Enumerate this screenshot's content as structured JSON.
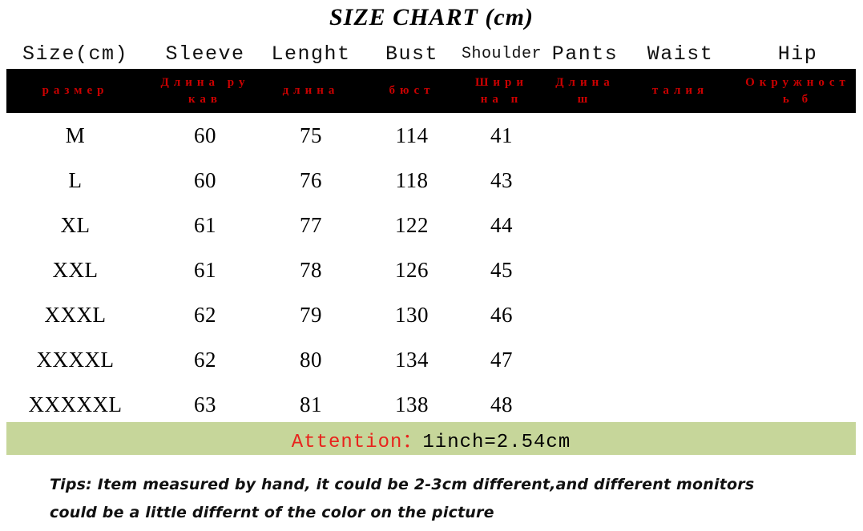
{
  "title": "SIZE CHART (cm)",
  "colors": {
    "band_black": "#000000",
    "cyrillic_red": "#cc0000",
    "attention_red": "#e8231c",
    "attention_band_green": "#c6d69a",
    "text_black": "#000000",
    "background": "#ffffff"
  },
  "table": {
    "headers_en": [
      "Size(cm)",
      "Sleeve",
      "Lenght",
      "Bust",
      "Shoulder",
      "Pants",
      "Waist",
      "Hip"
    ],
    "headers_ru": [
      "размер",
      "Длина рукав",
      "длина",
      "бюст",
      "Ширина п",
      "Длина ш",
      "талия",
      "Окружность б"
    ],
    "rows": [
      {
        "size": "M",
        "sleeve": "60",
        "length": "75",
        "bust": "114",
        "shoulder": "41",
        "pants": "",
        "waist": "",
        "hip": ""
      },
      {
        "size": "L",
        "sleeve": "60",
        "length": "76",
        "bust": "118",
        "shoulder": "43",
        "pants": "",
        "waist": "",
        "hip": ""
      },
      {
        "size": "XL",
        "sleeve": "61",
        "length": "77",
        "bust": "122",
        "shoulder": "44",
        "pants": "",
        "waist": "",
        "hip": ""
      },
      {
        "size": "XXL",
        "sleeve": "61",
        "length": "78",
        "bust": "126",
        "shoulder": "45",
        "pants": "",
        "waist": "",
        "hip": ""
      },
      {
        "size": "XXXL",
        "sleeve": "62",
        "length": "79",
        "bust": "130",
        "shoulder": "46",
        "pants": "",
        "waist": "",
        "hip": ""
      },
      {
        "size": "XXXXL",
        "sleeve": "62",
        "length": "80",
        "bust": "134",
        "shoulder": "47",
        "pants": "",
        "waist": "",
        "hip": ""
      },
      {
        "size": "XXXXXL",
        "sleeve": "63",
        "length": "81",
        "bust": "138",
        "shoulder": "48",
        "pants": "",
        "waist": "",
        "hip": ""
      }
    ]
  },
  "attention": {
    "label": "Attention：",
    "value": "1inch=2.54cm"
  },
  "tips": {
    "line1": "Tips: Item measured by hand, it could be 2-3cm different,and different monitors",
    "line2": "could be a little differnt of the color on the picture"
  }
}
